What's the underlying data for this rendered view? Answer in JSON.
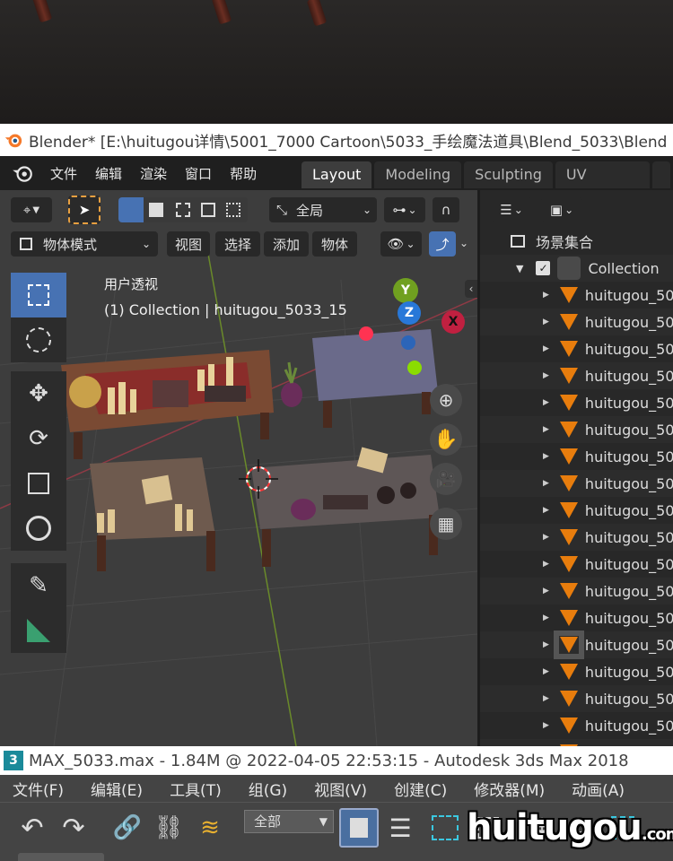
{
  "blender": {
    "title": "Blender* [E:\\huitugou详情\\5001_7000 Cartoon\\5033_手绘魔法道具\\Blend_5033\\Blend",
    "menu": [
      "文件",
      "编辑",
      "渲染",
      "窗口",
      "帮助"
    ],
    "workspaces": [
      "Layout",
      "Modeling",
      "Sculpting",
      "UV Editing"
    ],
    "active_workspace": "Layout",
    "viewport": {
      "orientation": "全局",
      "mode": "物体模式",
      "header_menu": [
        "视图",
        "选择",
        "添加",
        "物体"
      ],
      "view_name": "用户透视",
      "view_info": "(1) Collection | huitugou_5033_15",
      "axes": {
        "x": "X",
        "y": "Y",
        "z": "Z"
      }
    },
    "outliner": {
      "scene_collection": "场景集合",
      "collection": "Collection",
      "items": [
        "huitugou_50",
        "huitugou_50",
        "huitugou_50",
        "huitugou_50",
        "huitugou_50",
        "huitugou_50",
        "huitugou_50",
        "huitugou_50",
        "huitugou_50",
        "huitugou_50",
        "huitugou_50",
        "huitugou_50",
        "huitugou_50",
        "huitugou_50",
        "huitugou_50",
        "huitugou_50",
        "huitugou_50",
        "huitugou_50"
      ]
    }
  },
  "max": {
    "title": "MAX_5033.max - 1.84M @ 2022-04-05 22:53:15 - Autodesk 3ds Max 2018",
    "menu": [
      "文件(F)",
      "编辑(E)",
      "工具(T)",
      "组(G)",
      "视图(V)",
      "创建(C)",
      "修改器(M)",
      "动画(A)"
    ],
    "selection_filter": "全部"
  },
  "watermark": {
    "main": "huitugou",
    "suffix": ".com"
  },
  "colors": {
    "accent": "#4772b3",
    "orange": "#e87d0d",
    "axis_x": "#ff3352",
    "axis_y": "#8bdc00",
    "axis_z": "#2890ff"
  }
}
